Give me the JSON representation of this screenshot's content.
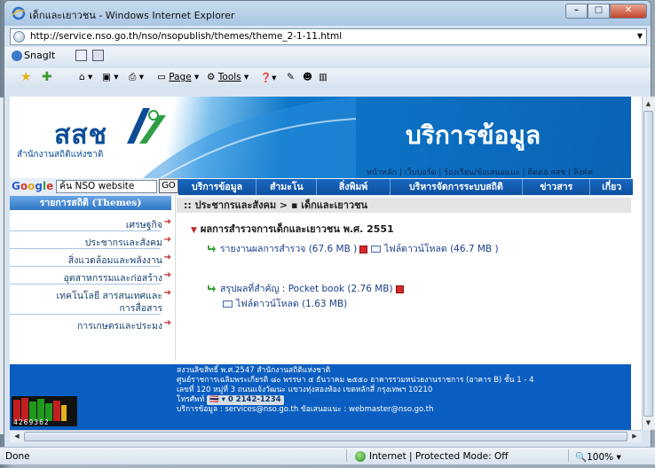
{
  "window": {
    "title": "เด็กและเยาวชน - Windows Internet Explorer",
    "controls": {
      "minimize": "–",
      "maximize": "□",
      "close": "✕"
    }
  },
  "address_bar": {
    "url": "http://service.nso.go.th/nso/nsopublish/themes/theme_2-1-11.html"
  },
  "snagit_bar": {
    "label": "SnagIt"
  },
  "command_bar": {
    "page_label": "Page",
    "tools_label": "Tools"
  },
  "site": {
    "logo_text": "สสช",
    "logo_subtitle": "สำนักงานสถิติแห่งชาติ",
    "header_title": "บริการข้อมูล",
    "top_links": "หน้าหลัก | เว็บบอร์ด | ร้องเรียน/ข้อเสนอแนะ | ติดต่อ สสช | ลิงค์ห",
    "google": {
      "g1": "G",
      "g2": "o",
      "g3": "o",
      "g4": "g",
      "g5": "l",
      "g6": "e"
    },
    "search_value": "ค้น NSO website",
    "search_button": "GO",
    "top_nav": [
      "บริการข้อมูล",
      "สำมะโน",
      "สิ่งพิมพ์",
      "บริหารจัดการระบบสถิติ",
      "ข่าวสาร",
      "เกี่ยว"
    ],
    "sidebar_title": "รายการสถิติ (Themes)",
    "sidebar_items": [
      "เศรษฐกิจ",
      "ประชากรและสังคม",
      "สิ่งแวดล้อมและพลังงาน",
      "อุตสาหกรรมและก่อสร้าง",
      "เทคโนโลยี สารสนเทศและ",
      "การสื่อสาร",
      "การเกษตรและประมง"
    ],
    "breadcrumb": ":: ประชากรและสังคม > ▪ เด็กและเยาวชน",
    "section_title": "ผลการสำรวจการเด็กและเยาวชน พ.ศ. 2551",
    "links": {
      "report": "รายงานผลการสำรวจ (67.6 MB )",
      "download1": "ไฟล์ดาวน์โหลด (46.7 MB )",
      "summary": "สรุปผลที่สำคัญ : Pocket book (2.76 MB)",
      "download2": "ไฟล์ดาวน์โหลด (1.63 MB)"
    },
    "counter": "4269362",
    "footer": {
      "line1": "สงวนลิขสิทธิ์ พ.ศ.2547 สำนักงานสถิติแห่งชาติ",
      "line2": "ศูนย์ราชการเฉลิมพระเกียรติ ๘๐ พรรษา ๕ ธันวาคม ๒๕๕๐ อาคารรวมหน่วยงานราชการ (อาคาร B) ชั้น 1 - 4",
      "line3": "เลขที่ 120 หมู่ที่ 3 ถนนแจ้งวัฒนะ แขวงทุ่งสองห้อง เขตหลักสี่ กรุงเทพฯ 10210",
      "phone_label": "โทรศัพท์",
      "phone": "0 2142-1234",
      "line5": "บริการข้อมูล : services@nso.go.th ข้อเสนอแนะ : webmaster@nso.go.th"
    }
  },
  "status_bar": {
    "state": "Done",
    "zone": "Internet | Protected Mode: Off",
    "zoom": "100%"
  }
}
